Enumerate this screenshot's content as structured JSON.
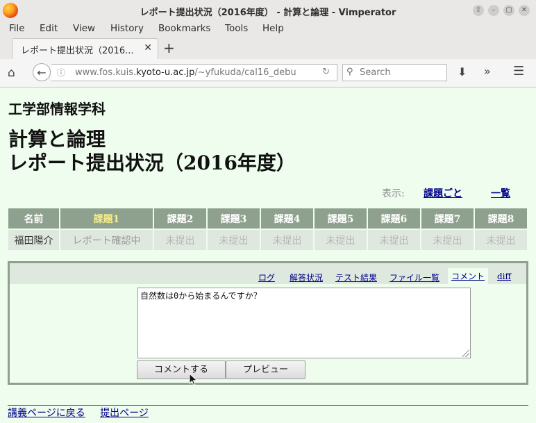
{
  "window": {
    "title": "レポート提出状況（2016年度） - 計算と論理 - Vimperator",
    "controls": [
      "⇧",
      "–",
      "▢",
      "✕"
    ]
  },
  "menu": [
    "File",
    "Edit",
    "View",
    "History",
    "Bookmarks",
    "Tools",
    "Help"
  ],
  "tab": {
    "label": "レポート提出状況（2016...",
    "close": "✕",
    "new": "+"
  },
  "nav": {
    "url_prefix": "www.fos.kuis.",
    "url_domain": "kyoto-u.ac.jp",
    "url_suffix": "/~yfukuda/cal16_debu",
    "search_placeholder": "Search"
  },
  "page": {
    "department": "工学部情報学科",
    "title_line1": "計算と論理",
    "title_line2": "レポート提出状況（2016年度）",
    "view_label": "表示:",
    "view_by_task": "課題ごと",
    "view_list": "一覧"
  },
  "table": {
    "headers": [
      "名前",
      "課題1",
      "課題2",
      "課題3",
      "課題4",
      "課題5",
      "課題6",
      "課題7",
      "課題8"
    ],
    "row": [
      "福田陽介",
      "レポート確認中",
      "未提出",
      "未提出",
      "未提出",
      "未提出",
      "未提出",
      "未提出",
      "未提出"
    ]
  },
  "panel": {
    "tabs": [
      "ログ",
      "解答状況",
      "テスト結果",
      "ファイル一覧",
      "コメント",
      "diff"
    ],
    "active_tab": "コメント",
    "comment": "自然数は0から始まるんですか？",
    "submit_button": "コメントする",
    "preview_button": "プレビュー"
  },
  "footer": {
    "back_link": "講義ページに戻る",
    "submit_link": "提出ページ"
  },
  "colors": {
    "page_bg": "#eefdee",
    "table_header": "#8ea08e",
    "link": "#00008b"
  }
}
